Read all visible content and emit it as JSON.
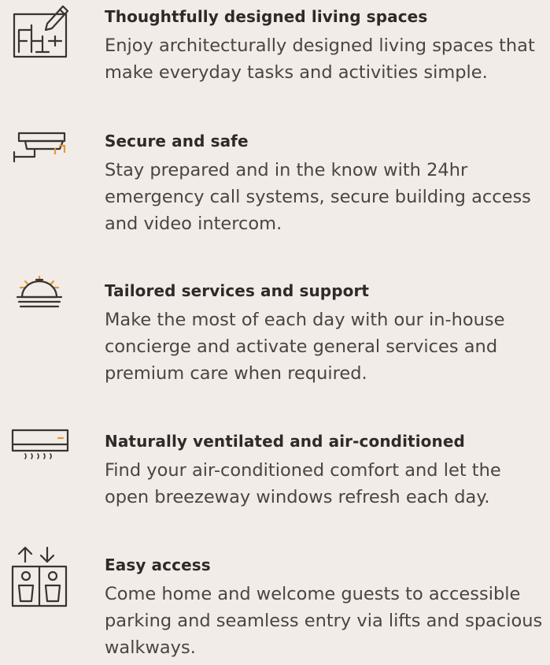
{
  "colors": {
    "text": "#2f2a27",
    "icon": "#3a3330",
    "accent": "#e8953a",
    "background": "#f1ece7"
  },
  "features": [
    {
      "icon": "floorplan-pencil-icon",
      "title": "Thoughtfully designed living spaces",
      "description": "Enjoy architecturally designed living spaces that make everyday tasks and activities simple."
    },
    {
      "icon": "security-camera-icon",
      "title": "Secure and safe",
      "description": "Stay prepared and in the know with 24hr emergency call systems, secure building access and video intercom."
    },
    {
      "icon": "service-bell-icon",
      "title": "Tailored services and support",
      "description": "Make the most of each day with our in-house concierge and activate general services and premium care when required."
    },
    {
      "icon": "air-conditioner-icon",
      "title": "Naturally ventilated and air-conditioned",
      "description": "Find your air-conditioned comfort and let the open breezeway windows refresh each day."
    },
    {
      "icon": "lift-icon",
      "title": "Easy access",
      "description": "Come home and welcome guests to accessible parking and seamless entry via lifts and spacious walkways."
    }
  ]
}
